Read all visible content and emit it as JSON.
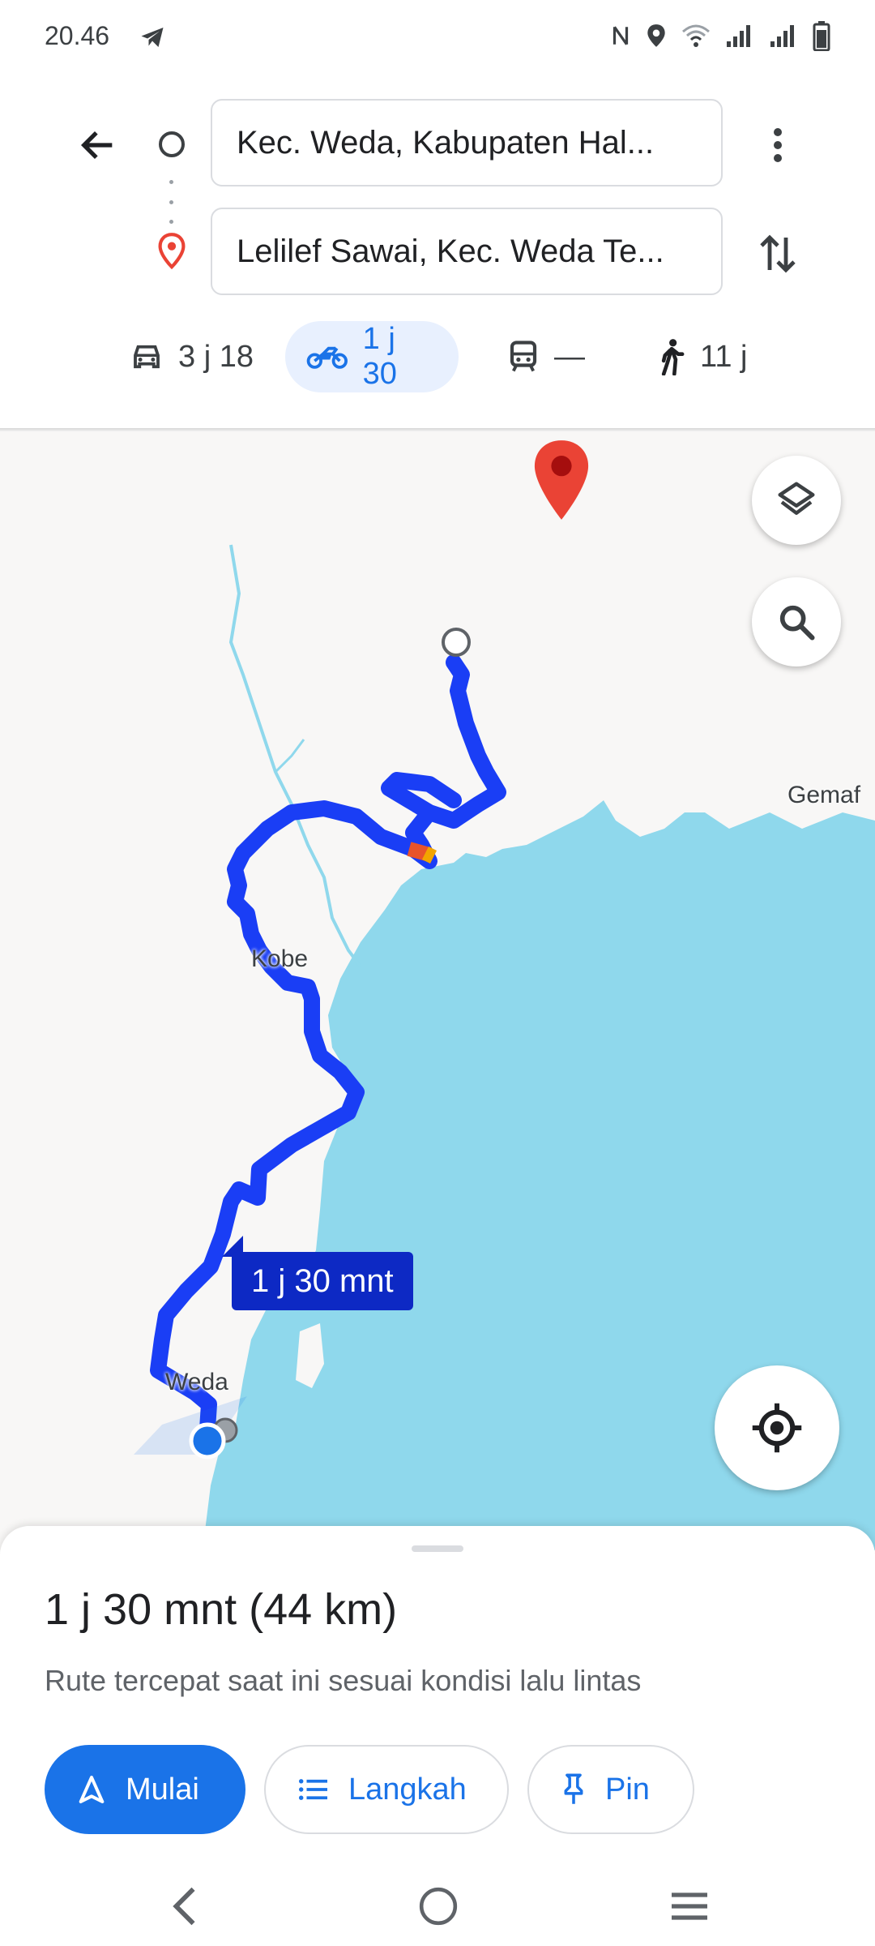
{
  "status_bar": {
    "time": "20.46",
    "icons": [
      "telegram-icon",
      "nfc-icon",
      "location-icon",
      "wifi-icon",
      "signal-icon",
      "signal-icon",
      "battery-icon"
    ]
  },
  "directions": {
    "origin": "Kec. Weda, Kabupaten Hal...",
    "destination": "Lelilef Sawai, Kec. Weda Te...",
    "modes": [
      {
        "icon": "car-icon",
        "label": "3 j 18",
        "selected": false
      },
      {
        "icon": "motorcycle-icon",
        "label": "1 j 30",
        "selected": true
      },
      {
        "icon": "transit-icon",
        "label": "—",
        "selected": false
      },
      {
        "icon": "walk-icon",
        "label": "11 j",
        "selected": false
      }
    ]
  },
  "map": {
    "labels": {
      "gemaf": "Gemaf",
      "kobe": "Kobe",
      "weda": "Weda"
    },
    "eta_badge": "1 j 30 mnt",
    "colors": {
      "route": "#1a3ef5",
      "water": "#8fd8ec",
      "land": "#f8f7f6",
      "traffic": "#e8532a"
    }
  },
  "sheet": {
    "summary": "1 j 30 mnt (44 km)",
    "subtitle": "Rute tercepat saat ini sesuai kondisi lalu lintas",
    "start_label": "Mulai",
    "steps_label": "Langkah",
    "pin_label": "Pin"
  },
  "colors": {
    "accent": "#1a73e8",
    "selected_tab_bg": "#e8f0fe",
    "pin_red": "#ea4335"
  }
}
